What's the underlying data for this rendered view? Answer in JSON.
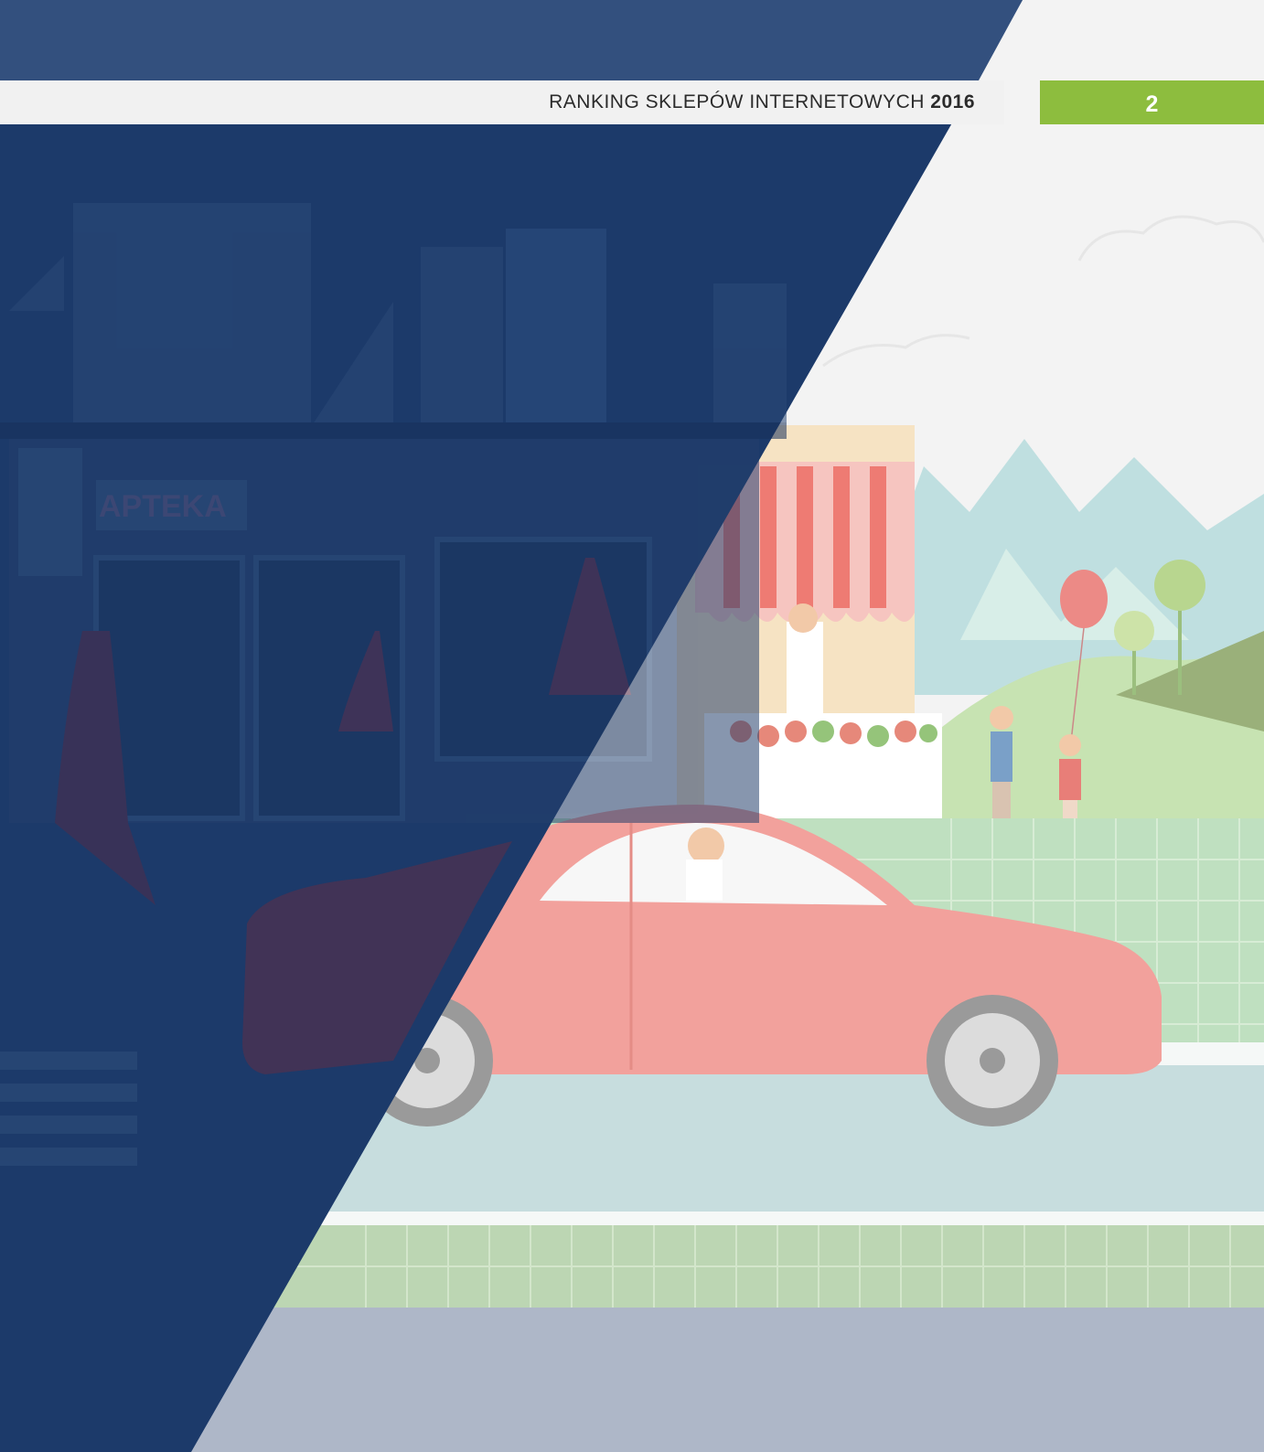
{
  "header": {
    "title_main": "RANKING SKLEPÓW INTERNETOWYCH",
    "title_year": "2016",
    "page_number": "2"
  },
  "illustration": {
    "shop_sign": "APTEKA"
  },
  "colors": {
    "navy": "#33507e",
    "navy_overlay": "#1c3a6a",
    "accent_green": "#8dbd3e",
    "header_bar": "#f1f1f1",
    "car_red": "#ee7b73",
    "grass": "#bcd6b3",
    "footer_strip": "#aeb7c8"
  }
}
